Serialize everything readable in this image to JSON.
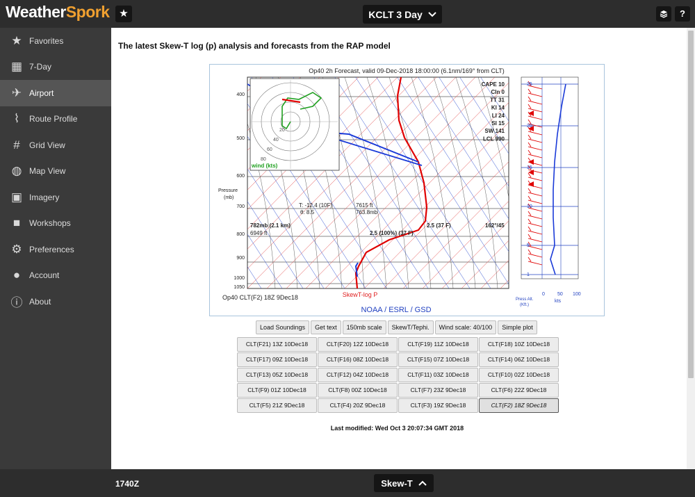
{
  "app": {
    "name_part1": "Weather",
    "name_part2": "Spork"
  },
  "topbar": {
    "location_label": "KCLT  3 Day"
  },
  "sidebar": {
    "items": [
      {
        "label": "Favorites",
        "icon": "star-icon"
      },
      {
        "label": "7-Day",
        "icon": "calendar-icon"
      },
      {
        "label": "Airport",
        "icon": "plane-takeoff-icon",
        "active": true
      },
      {
        "label": "Route Profile",
        "icon": "route-icon"
      },
      {
        "label": "Grid View",
        "icon": "hashtag-icon"
      },
      {
        "label": "Map View",
        "icon": "globe-icon"
      },
      {
        "label": "Imagery",
        "icon": "image-icon"
      },
      {
        "label": "Workshops",
        "icon": "video-camera-icon"
      },
      {
        "label": "Preferences",
        "icon": "gear-icon"
      },
      {
        "label": "Account",
        "icon": "user-icon"
      },
      {
        "label": "About",
        "icon": "info-icon"
      }
    ]
  },
  "main": {
    "heading": "The latest Skew-T log (p) analysis and forecasts from the RAP model",
    "plot": {
      "title": "Op40 2h Forecast, valid 09-Dec-2018 18:00:00 (6.1nm/169° from CLT)",
      "pressure_label": "Pressure",
      "pressure_unit": "(mb)",
      "pressure_ticks": [
        "400",
        "500",
        "600",
        "700",
        "800",
        "900",
        "1000",
        "1050"
      ],
      "indices": [
        "CAPE 10",
        "CIn 0",
        "TT 31",
        "KI 14",
        "LI 24",
        "SI 15",
        "SW 141",
        "LCL 990"
      ],
      "hodo_label": "wind (kts)",
      "hodo_rings": [
        "20",
        "40",
        "60",
        "80"
      ],
      "cursor_t": "T: -12.4 (10F)",
      "cursor_theta": "θ: 8.5",
      "cursor_ft": "7615 ft",
      "cursor_mb": "763.8mb",
      "level_mb": "782mb (2.1 km)",
      "level_ft": "6949 ft",
      "temp_label": "2.5 (37 F)",
      "dew_label": "2.5 (100%) (37 F)",
      "wind_label": "162°/45",
      "footer_left": "Op40 CLT(F2) 18Z 9Dec18",
      "footer_center": "SkewT-log P",
      "footer_credit": "NOAA / ESRL / GSD",
      "alt_label_1": "Press Alt.",
      "alt_label_2": "(Kft.)",
      "kts_ticks": [
        "0",
        "50",
        "100"
      ],
      "kts_label": "kts",
      "alt_ticks": [
        "25",
        "20",
        "15",
        "10",
        "5",
        "1"
      ]
    },
    "controls": [
      "Load Soundings",
      "Get text",
      "150mb scale",
      "SkewT/Tephi.",
      "Wind scale: 40/100",
      "Simple plot"
    ],
    "soundings": [
      "CLT(F21) 13Z 10Dec18",
      "CLT(F20) 12Z 10Dec18",
      "CLT(F19) 11Z 10Dec18",
      "CLT(F18) 10Z 10Dec18",
      "CLT(F17) 09Z 10Dec18",
      "CLT(F16) 08Z 10Dec18",
      "CLT(F15) 07Z 10Dec18",
      "CLT(F14) 06Z 10Dec18",
      "CLT(F13) 05Z 10Dec18",
      "CLT(F12) 04Z 10Dec18",
      "CLT(F11) 03Z 10Dec18",
      "CLT(F10) 02Z 10Dec18",
      "CLT(F9) 01Z 10Dec18",
      "CLT(F8) 00Z 10Dec18",
      "CLT(F7) 23Z 9Dec18",
      "CLT(F6) 22Z 9Dec18",
      "CLT(F5) 21Z 9Dec18",
      "CLT(F4) 20Z 9Dec18",
      "CLT(F3) 19Z 9Dec18",
      "CLT(F2) 18Z 9Dec18"
    ],
    "selected_sounding": "CLT(F2) 18Z 9Dec18",
    "last_modified": "Last modified: Wed Oct 3 20:07:34 GMT 2018"
  },
  "bottombar": {
    "zulu_time": "1740Z",
    "view_label": "Skew-T"
  },
  "colors": {
    "accent": "#f0a030",
    "sidebar": "#3a3a3a",
    "topbar": "#2d2d2d",
    "temp": "#e00000",
    "wind": "#1a3ad8",
    "hodo": "#20a020"
  }
}
